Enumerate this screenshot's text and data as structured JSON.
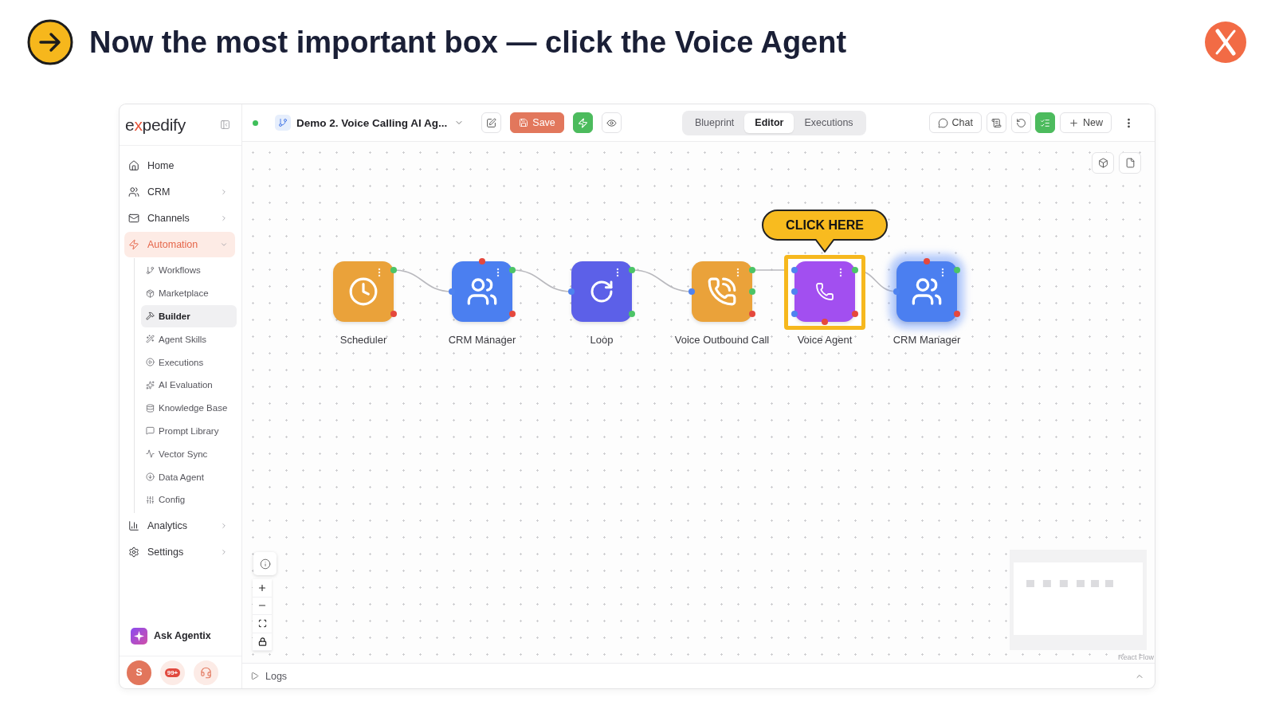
{
  "slide": {
    "title": "Now the most important box — click the Voice Agent"
  },
  "sidebar": {
    "logo": "expedify",
    "items": [
      {
        "label": "Home",
        "selected": false
      },
      {
        "label": "CRM",
        "selected": false,
        "expanded": false
      },
      {
        "label": "Channels",
        "selected": false,
        "expanded": false
      },
      {
        "label": "Automation",
        "selected": true,
        "expanded": true,
        "children": [
          {
            "label": "Workflows",
            "selected": false
          },
          {
            "label": "Marketplace",
            "selected": false
          },
          {
            "label": "Builder",
            "selected": true
          },
          {
            "label": "Agent Skills",
            "selected": false
          },
          {
            "label": "Executions",
            "selected": false
          },
          {
            "label": "AI Evaluation",
            "selected": false
          },
          {
            "label": "Knowledge Base",
            "selected": false
          },
          {
            "label": "Prompt Library",
            "selected": false
          },
          {
            "label": "Vector Sync",
            "selected": false
          },
          {
            "label": "Data Agent",
            "selected": false
          },
          {
            "label": "Config",
            "selected": false
          }
        ]
      },
      {
        "label": "Analytics",
        "selected": false,
        "expanded": false
      },
      {
        "label": "Settings",
        "selected": false,
        "expanded": false
      }
    ],
    "assistant": "Ask Agentix",
    "user_initial": "S",
    "notification_count": "99+"
  },
  "topbar": {
    "online": true,
    "workflow_title": "Demo 2. Voice Calling AI Ag...",
    "save_button": "Save",
    "tabs": [
      {
        "label": "Blueprint",
        "selected": false
      },
      {
        "label": "Editor",
        "selected": true
      },
      {
        "label": "Executions",
        "selected": false
      }
    ],
    "chat_button": "Chat",
    "new_button": "New"
  },
  "canvas": {
    "nodes": [
      {
        "label": "Scheduler",
        "kind": "scheduler",
        "color": "#eaa23a",
        "selected": false,
        "highlighted": false
      },
      {
        "label": "CRM Manager",
        "kind": "crm",
        "color": "#4b7ff0",
        "selected": false,
        "highlighted": false
      },
      {
        "label": "Loop",
        "kind": "loop",
        "color": "#5c60e8",
        "selected": false,
        "highlighted": false
      },
      {
        "label": "Voice Outbound Call",
        "kind": "call",
        "color": "#eaa23a",
        "selected": false,
        "highlighted": false
      },
      {
        "label": "Voice Agent",
        "kind": "voice-agent",
        "color": "#a24ff0",
        "selected": false,
        "highlighted": true
      },
      {
        "label": "CRM Manager",
        "kind": "crm",
        "color": "#4b7ff0",
        "selected": true,
        "highlighted": false
      }
    ],
    "callout": "CLICK HERE",
    "attribution": "React Flow"
  },
  "logs": {
    "label": "Logs",
    "expanded": false
  }
}
